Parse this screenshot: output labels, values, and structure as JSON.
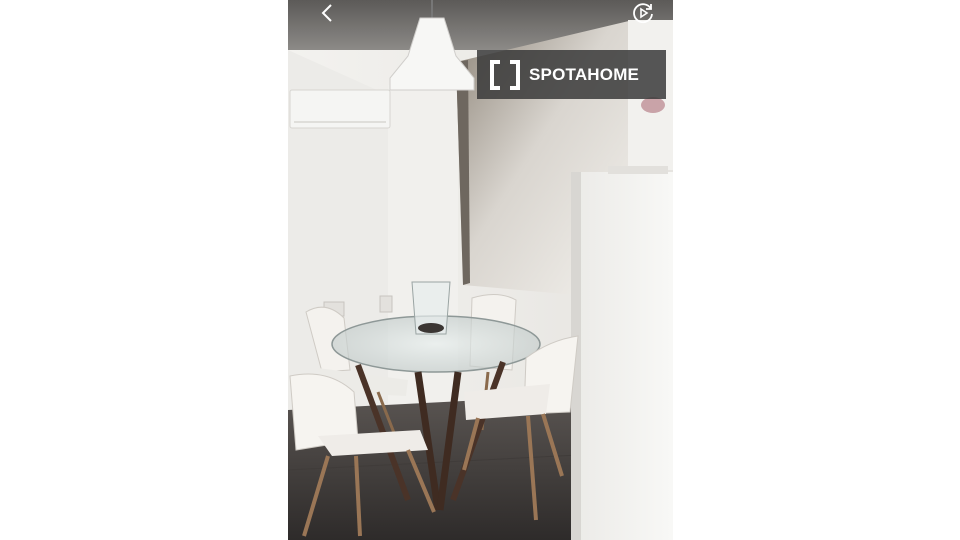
{
  "watermark": {
    "brand": "SPOTAHOME",
    "icon": "bracket-logo-icon"
  },
  "controls": {
    "back_icon": "chevron-left-icon",
    "media_icon": "play-circle-icon"
  },
  "colors": {
    "page_background": "#ffffff",
    "watermark_background": "#3a3a3a",
    "watermark_text": "#ffffff"
  }
}
